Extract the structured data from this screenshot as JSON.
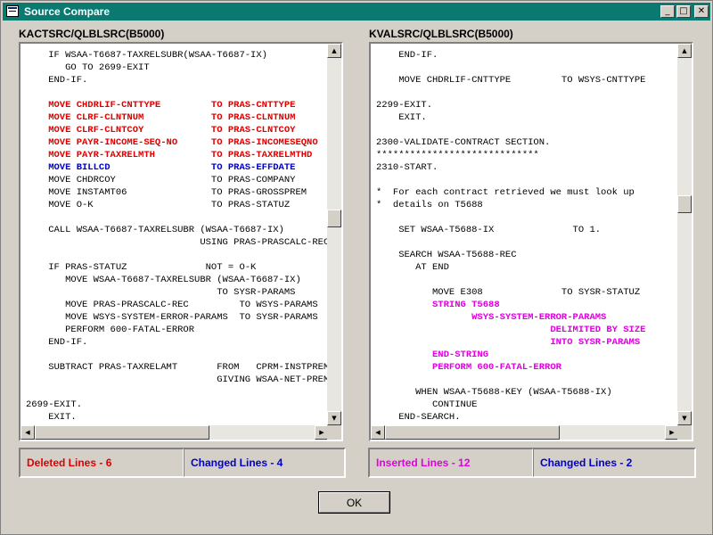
{
  "window": {
    "title": "Source Compare",
    "icon": "window-list-icon"
  },
  "colors": {
    "deleted": "#e00000",
    "changed": "#0000c8",
    "inserted": "#e000e0",
    "normal": "#000000",
    "titlebar": "#0a7a70"
  },
  "left": {
    "title": "KACTSRC/QLBLSRC(B5000)",
    "lines": [
      {
        "text": "    IF WSAA-T6687-TAXRELSUBR(WSAA-T6687-IX)",
        "style": "normal"
      },
      {
        "text": "       GO TO 2699-EXIT",
        "style": "normal"
      },
      {
        "text": "    END-IF.",
        "style": "normal"
      },
      {
        "text": "",
        "style": "normal"
      },
      {
        "text": "    MOVE CHDRLIF-CNTTYPE         TO PRAS-CNTTYPE",
        "style": "deleted"
      },
      {
        "text": "    MOVE CLRF-CLNTNUM            TO PRAS-CLNTNUM",
        "style": "deleted"
      },
      {
        "text": "    MOVE CLRF-CLNTCOY            TO PRAS-CLNTCOY",
        "style": "deleted"
      },
      {
        "text": "    MOVE PAYR-INCOME-SEQ-NO      TO PRAS-INCOMESEQNO",
        "style": "deleted"
      },
      {
        "text": "    MOVE PAYR-TAXRELMTH          TO PRAS-TAXRELMTHD",
        "style": "deleted"
      },
      {
        "text": "    MOVE BILLCD                  TO PRAS-EFFDATE",
        "style": "changed"
      },
      {
        "text": "    MOVE CHDRCOY                 TO PRAS-COMPANY",
        "style": "normal"
      },
      {
        "text": "    MOVE INSTAMT06               TO PRAS-GROSSPREM",
        "style": "normal"
      },
      {
        "text": "    MOVE O-K                     TO PRAS-STATUZ",
        "style": "normal"
      },
      {
        "text": "",
        "style": "normal"
      },
      {
        "text": "    CALL WSAA-T6687-TAXRELSUBR (WSAA-T6687-IX)",
        "style": "normal"
      },
      {
        "text": "                               USING PRAS-PRASCALC-REC",
        "style": "normal"
      },
      {
        "text": "",
        "style": "normal"
      },
      {
        "text": "    IF PRAS-STATUZ              NOT = O-K",
        "style": "normal"
      },
      {
        "text": "       MOVE WSAA-T6687-TAXRELSUBR (WSAA-T6687-IX)",
        "style": "normal"
      },
      {
        "text": "                                  TO SYSR-PARAMS",
        "style": "normal"
      },
      {
        "text": "       MOVE PRAS-PRASCALC-REC         TO WSYS-PARAMS",
        "style": "normal"
      },
      {
        "text": "       MOVE WSYS-SYSTEM-ERROR-PARAMS  TO SYSR-PARAMS",
        "style": "normal"
      },
      {
        "text": "       PERFORM 600-FATAL-ERROR",
        "style": "normal"
      },
      {
        "text": "    END-IF.",
        "style": "normal"
      },
      {
        "text": "",
        "style": "normal"
      },
      {
        "text": "    SUBTRACT PRAS-TAXRELAMT       FROM   CPRM-INSTPREM",
        "style": "normal"
      },
      {
        "text": "                                  GIVING WSAA-NET-PREM",
        "style": "normal"
      },
      {
        "text": "",
        "style": "normal"
      },
      {
        "text": "2699-EXIT.",
        "style": "normal"
      },
      {
        "text": "    EXIT.",
        "style": "normal"
      }
    ],
    "status": {
      "left_label": "Deleted Lines - 6",
      "right_label": "Changed Lines - 4"
    }
  },
  "right": {
    "title": "KVALSRC/QLBLSRC(B5000)",
    "lines": [
      {
        "text": "    END-IF.",
        "style": "normal"
      },
      {
        "text": "",
        "style": "normal"
      },
      {
        "text": "    MOVE CHDRLIF-CNTTYPE         TO WSYS-CNTTYPE",
        "style": "normal"
      },
      {
        "text": "",
        "style": "normal"
      },
      {
        "text": "2299-EXIT.",
        "style": "normal"
      },
      {
        "text": "    EXIT.",
        "style": "normal"
      },
      {
        "text": "",
        "style": "normal"
      },
      {
        "text": "2300-VALIDATE-CONTRACT SECTION.",
        "style": "normal"
      },
      {
        "text": "*****************************",
        "style": "normal"
      },
      {
        "text": "2310-START.",
        "style": "normal"
      },
      {
        "text": "",
        "style": "normal"
      },
      {
        "text": "*  For each contract retrieved we must look up",
        "style": "normal"
      },
      {
        "text": "*  details on T5688",
        "style": "normal"
      },
      {
        "text": "",
        "style": "normal"
      },
      {
        "text": "    SET WSAA-T5688-IX              TO 1.",
        "style": "normal"
      },
      {
        "text": "",
        "style": "normal"
      },
      {
        "text": "    SEARCH WSAA-T5688-REC",
        "style": "normal"
      },
      {
        "text": "       AT END",
        "style": "normal"
      },
      {
        "text": "",
        "style": "normal"
      },
      {
        "text": "          MOVE E308              TO SYSR-STATUZ",
        "style": "normal"
      },
      {
        "text": "          STRING T5688",
        "style": "inserted"
      },
      {
        "text": "                 WSYS-SYSTEM-ERROR-PARAMS",
        "style": "inserted"
      },
      {
        "text": "                               DELIMITED BY SIZE",
        "style": "inserted"
      },
      {
        "text": "                               INTO SYSR-PARAMS",
        "style": "inserted"
      },
      {
        "text": "          END-STRING",
        "style": "inserted"
      },
      {
        "text": "          PERFORM 600-FATAL-ERROR",
        "style": "inserted"
      },
      {
        "text": "",
        "style": "normal"
      },
      {
        "text": "       WHEN WSAA-T5688-KEY (WSAA-T5688-IX)",
        "style": "normal"
      },
      {
        "text": "          CONTINUE",
        "style": "normal"
      },
      {
        "text": "    END-SEARCH.",
        "style": "normal"
      }
    ],
    "status": {
      "left_label": "Inserted Lines - 12",
      "right_label": "Changed Lines - 2"
    }
  },
  "buttons": {
    "ok": "OK",
    "minimize": "_",
    "maximize": "□",
    "close": "✕"
  },
  "scroll": {
    "up": "▲",
    "down": "▼",
    "left": "◀",
    "right": "▶"
  }
}
